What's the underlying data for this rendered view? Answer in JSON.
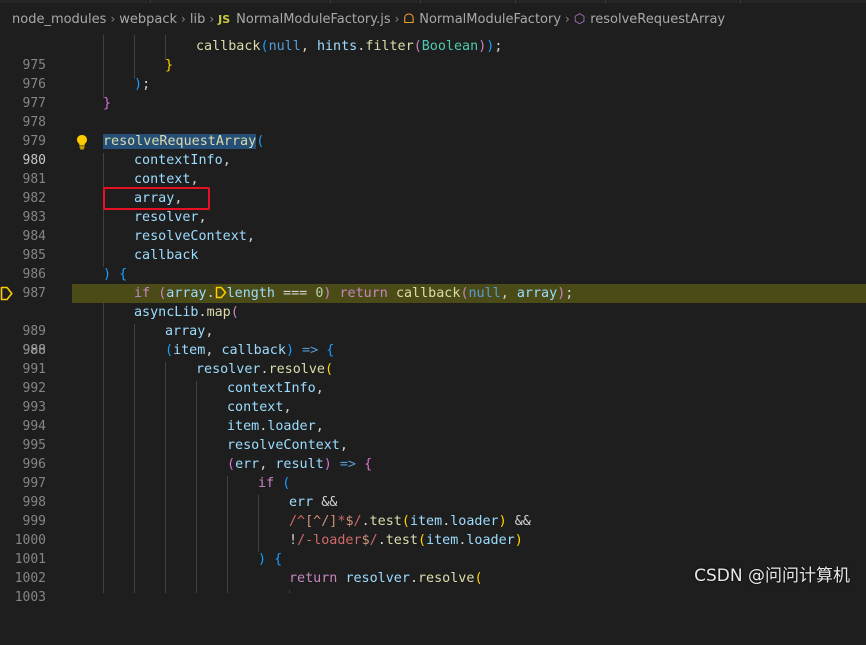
{
  "breadcrumb": {
    "segments": [
      "node_modules",
      "webpack",
      "lib",
      "NormalModuleFactory.js",
      "NormalModuleFactory",
      "resolveRequestArray"
    ],
    "file_type_label": "JS"
  },
  "editor": {
    "active_line": "980",
    "breakpoint_line": "988",
    "line_numbers": [
      "975",
      "976",
      "977",
      "978",
      "979",
      "980",
      "981",
      "982",
      "983",
      "984",
      "985",
      "986",
      "987",
      "988",
      "989",
      "990",
      "991",
      "992",
      "993",
      "994",
      "995",
      "996",
      "997",
      "998",
      "999",
      "1000",
      "1001",
      "1002",
      "1003"
    ],
    "highlighted_token": "array"
  },
  "icons": {
    "lightbulb": "lightbulb-icon",
    "breakpoint": "debug-breakpoint-icon",
    "inline_breakpoint": "inline-breakpoint-icon",
    "class": "class-icon",
    "method": "method-icon"
  },
  "colors": {
    "background": "#1e1e1e",
    "current_line": "#4b4b18",
    "highlight_box": "#e81123"
  },
  "watermark": "CSDN @问问计算机"
}
